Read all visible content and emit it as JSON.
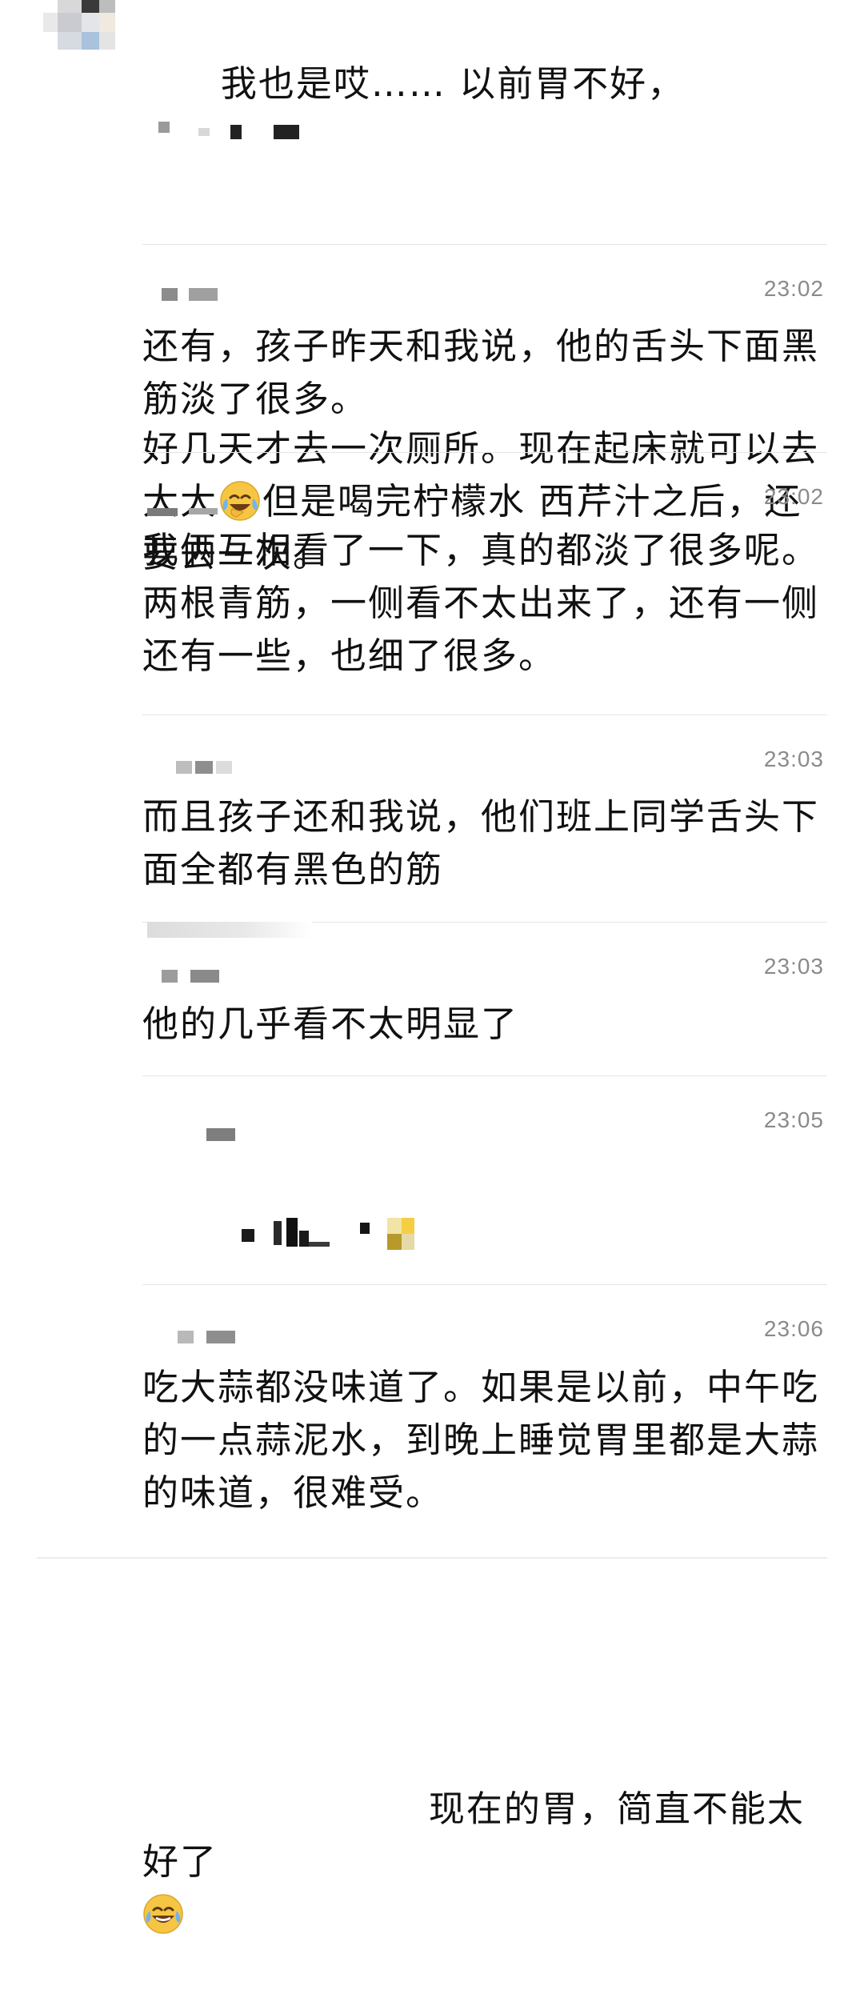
{
  "comments": [
    {
      "text_part1": "我也是哎…… 以前胃不好，",
      "text_part2": "好几天才去一次厕所。现在起床就可以去大大",
      "text_part3": "但是喝完柠檬水 西芹汁之后，还要去一次。",
      "emoji": "laughing-crying-emoji"
    },
    {
      "time": "23:02",
      "text": "还有，孩子昨天和我说，他的舌头下面黑筋淡了很多。"
    },
    {
      "time": "23:02",
      "text": "我俩互相看了一下，真的都淡了很多呢。两根青筋，一侧看不太出来了，还有一侧还有一些，也细了很多。"
    },
    {
      "time": "23:03",
      "text": "而且孩子还和我说，他们班上同学舌头下面全都有黑色的筋"
    },
    {
      "time": "23:03",
      "text": "他的几乎看不太明显了"
    },
    {
      "time": "23:05",
      "text": "现在的胃，简直不能太好了",
      "emoji": "laughing-crying-emoji"
    },
    {
      "time": "23:06",
      "text": "吃大蒜都没味道了。如果是以前，中午吃的一点蒜泥水，到晚上睡觉胃里都是大蒜的味道，很难受。"
    }
  ],
  "colors": {
    "text": "#111111",
    "time": "#8a8a8a",
    "divider": "#e4e4e4",
    "emoji_face": "#f6c543"
  }
}
